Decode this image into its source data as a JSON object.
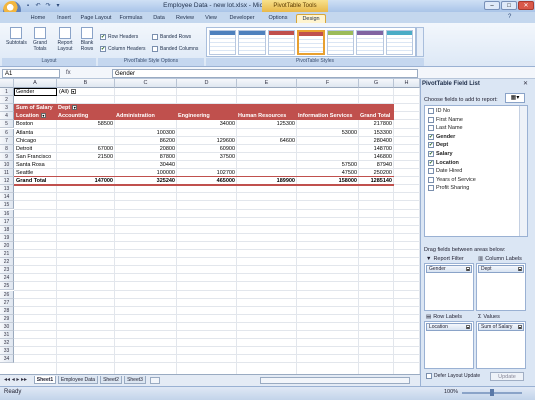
{
  "window": {
    "title": "Employee Data - new lot.xlsx - Microsoft Excel",
    "context_banner": "PivotTable Tools"
  },
  "ribbon": {
    "tabs": [
      "Home",
      "Insert",
      "Page Layout",
      "Formulas",
      "Data",
      "Review",
      "View",
      "Developer",
      "Options",
      "Design"
    ],
    "active_tab": "Design",
    "layout_group": {
      "label": "Layout",
      "subtotals": "Subtotals",
      "grand_totals": "Grand Totals",
      "report_layout": "Report Layout",
      "blank_rows": "Blank Rows"
    },
    "style_options_group": {
      "label": "PivotTable Style Options",
      "row_headers": "Row Headers",
      "column_headers": "Column Headers",
      "banded_rows": "Banded Rows",
      "banded_columns": "Banded Columns"
    },
    "styles_group": {
      "label": "PivotTable Styles"
    }
  },
  "formula_bar": {
    "name_box": "A1",
    "fx": "fx",
    "content": "Gender"
  },
  "sheet": {
    "columns": [
      "A",
      "B",
      "C",
      "D",
      "E",
      "F",
      "G",
      "H"
    ],
    "rows": [
      "1",
      "2",
      "3",
      "4",
      "5",
      "6",
      "7",
      "8",
      "9",
      "10",
      "11",
      "12",
      "13",
      "14",
      "15",
      "16",
      "17",
      "18",
      "19",
      "20",
      "21",
      "22",
      "23",
      "24",
      "25",
      "26",
      "27",
      "28",
      "29",
      "30",
      "31",
      "32",
      "33",
      "34"
    ],
    "filter": {
      "field": "Gender",
      "value": "(All)"
    },
    "pivot": {
      "values_label": "Sum of Salary",
      "col_field": "Dept",
      "row_field": "Location",
      "col_headers": [
        "Accounting",
        "Administration",
        "Engineering",
        "Human Resources",
        "Information Services",
        "Grand Total"
      ],
      "rows": [
        {
          "label": "Boston",
          "values": [
            "58500",
            "",
            "34000",
            "125300",
            "",
            "217800"
          ]
        },
        {
          "label": "Atlanta",
          "values": [
            "",
            "100300",
            "",
            "",
            "53000",
            "153300"
          ]
        },
        {
          "label": "Chicago",
          "values": [
            "",
            "86200",
            "129600",
            "64600",
            "",
            "280400"
          ]
        },
        {
          "label": "Detroit",
          "values": [
            "67000",
            "20800",
            "60900",
            "",
            "",
            "148700"
          ]
        },
        {
          "label": "San Francisco",
          "values": [
            "21500",
            "87800",
            "37500",
            "",
            "",
            "146800"
          ]
        },
        {
          "label": "Santa Rosa",
          "values": [
            "",
            "30440",
            "",
            "",
            "57500",
            "87940"
          ]
        },
        {
          "label": "Seattle",
          "values": [
            "",
            "100000",
            "102700",
            "",
            "47500",
            "250200"
          ]
        }
      ],
      "grand_total": {
        "label": "Grand Total",
        "values": [
          "147000",
          "325240",
          "465000",
          "189900",
          "158000",
          "1285140"
        ]
      }
    },
    "tabs": [
      "Sheet1",
      "Employee Data",
      "Sheet2",
      "Sheet3"
    ],
    "active_tab": "Sheet1"
  },
  "field_list": {
    "title": "PivotTable Field List",
    "choose_label": "Choose fields to add to report:",
    "fields": [
      {
        "name": "ID No",
        "checked": false
      },
      {
        "name": "First Name",
        "checked": false
      },
      {
        "name": "Last Name",
        "checked": false
      },
      {
        "name": "Gender",
        "checked": true
      },
      {
        "name": "Dept",
        "checked": true
      },
      {
        "name": "Salary",
        "checked": true
      },
      {
        "name": "Location",
        "checked": true
      },
      {
        "name": "Date Hired",
        "checked": false
      },
      {
        "name": "Years of Service",
        "checked": false
      },
      {
        "name": "Profit Sharing",
        "checked": false
      }
    ],
    "drag_label": "Drag fields between areas below:",
    "areas": {
      "report_filter": {
        "label": "Report Filter",
        "item": "Gender"
      },
      "column_labels": {
        "label": "Column Labels",
        "item": "Dept"
      },
      "row_labels": {
        "label": "Row Labels",
        "item": "Location"
      },
      "values": {
        "label": "Values",
        "item": "Sum of Salary"
      }
    },
    "defer_label": "Defer Layout Update",
    "update_label": "Update"
  },
  "status": {
    "ready": "Ready",
    "zoom": "100%"
  }
}
